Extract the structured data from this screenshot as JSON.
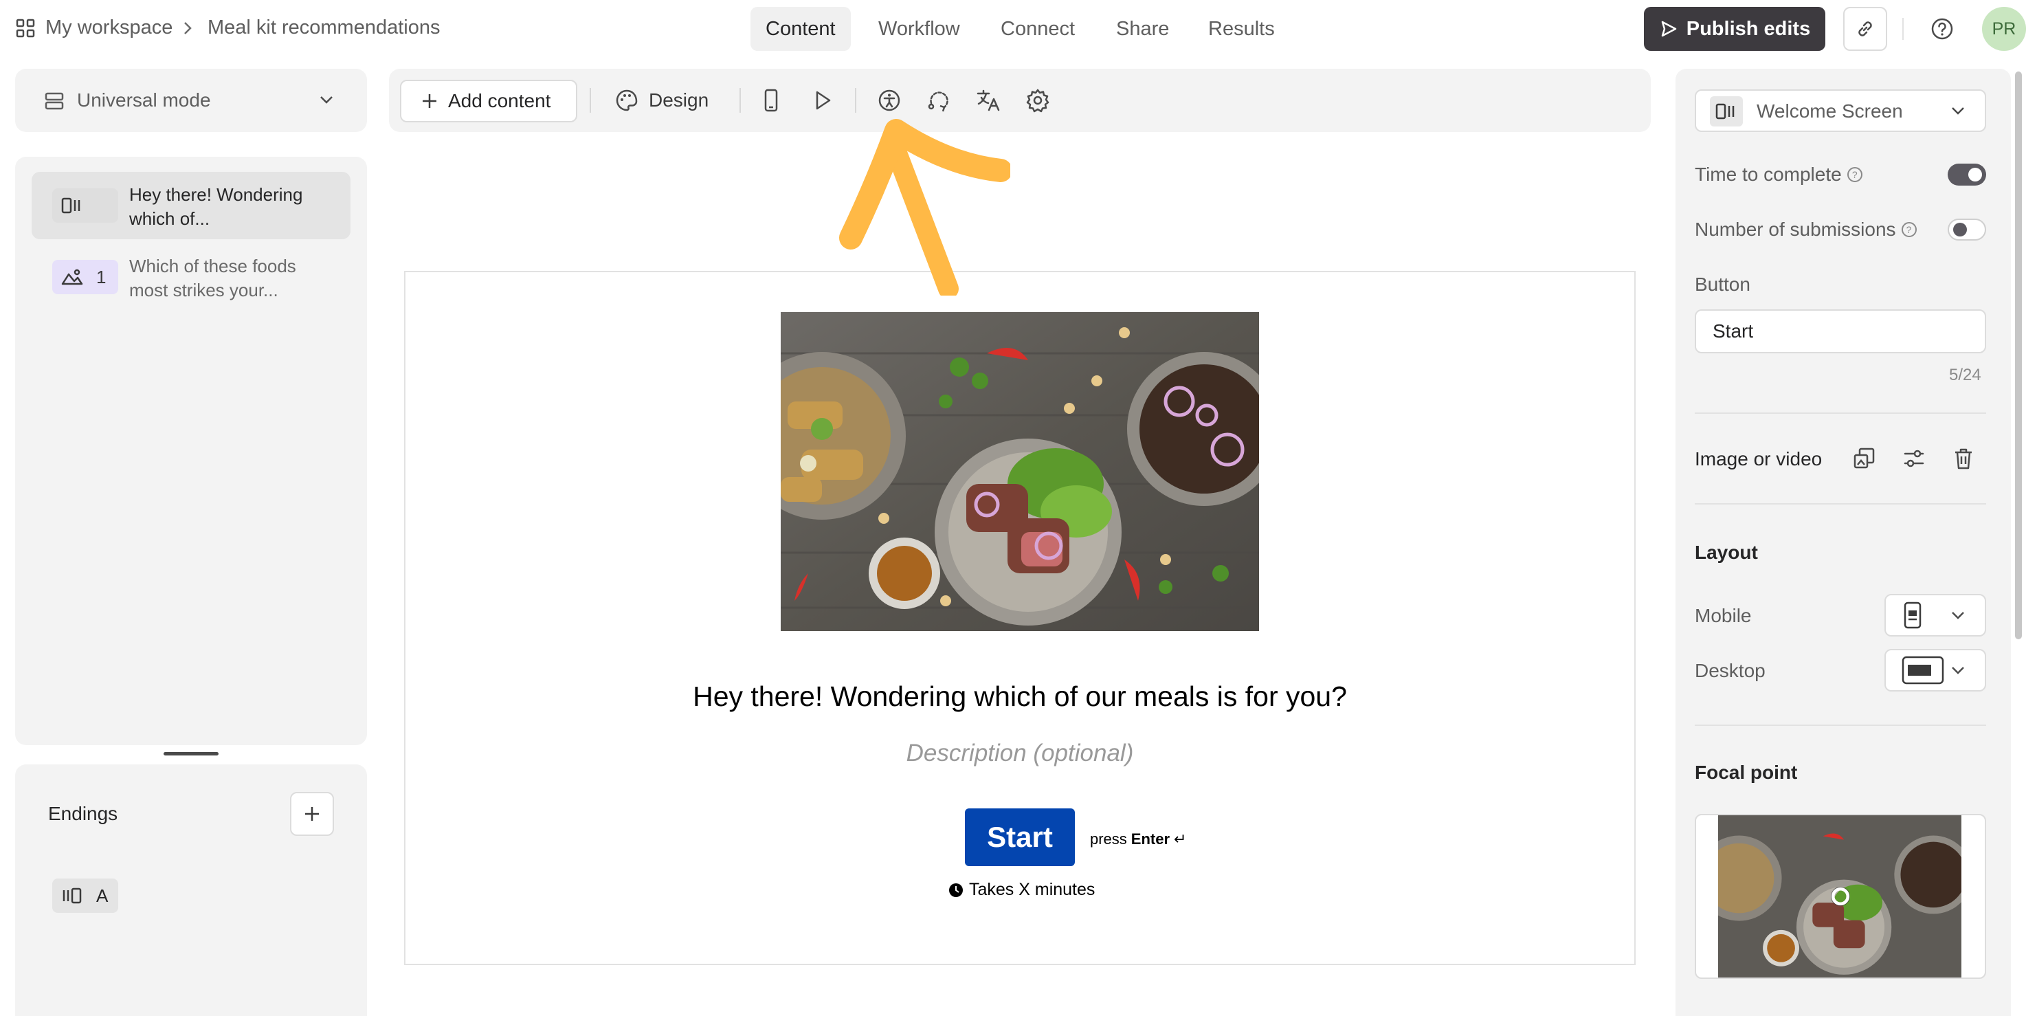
{
  "topbar": {
    "breadcrumb_workspace": "My workspace",
    "breadcrumb_form": "Meal kit recommendations",
    "tabs": [
      {
        "label": "Content",
        "active": true
      },
      {
        "label": "Workflow",
        "active": false
      },
      {
        "label": "Connect",
        "active": false
      },
      {
        "label": "Share",
        "active": false
      },
      {
        "label": "Results",
        "active": false
      }
    ],
    "publish_label": "Publish edits",
    "avatar_initials": "PR"
  },
  "left": {
    "mode_label": "Universal mode",
    "questions": [
      {
        "badge": "",
        "icon": "welcome-screen-icon",
        "text": "Hey there! Wondering which of..."
      },
      {
        "badge": "1",
        "icon": "picture-choice-icon",
        "text": "Which of these foods most strikes your..."
      }
    ],
    "endings_label": "Endings",
    "ending_badge": "A"
  },
  "toolbar": {
    "add_content_label": "Add content",
    "design_label": "Design"
  },
  "canvas": {
    "title": "Hey there! Wondering which of our meals is for you?",
    "description_placeholder": "Description (optional)",
    "start_label": "Start",
    "press_label": "press",
    "enter_label": "Enter",
    "enter_glyph": "↵",
    "takes_label": "Takes X minutes"
  },
  "right": {
    "screen_type": "Welcome Screen",
    "time_to_complete_label": "Time to complete",
    "time_to_complete_on": true,
    "submissions_label": "Number of submissions",
    "submissions_on": false,
    "button_section_label": "Button",
    "button_value": "Start",
    "char_count": "5/24",
    "image_video_label": "Image or video",
    "layout_label": "Layout",
    "mobile_label": "Mobile",
    "desktop_label": "Desktop",
    "focal_point_label": "Focal point"
  },
  "colors": {
    "accent_button": "#0445af",
    "publish_bg": "#3d3a3f",
    "arrow": "#ffb946",
    "badge_purple": "#e6e0fa"
  }
}
